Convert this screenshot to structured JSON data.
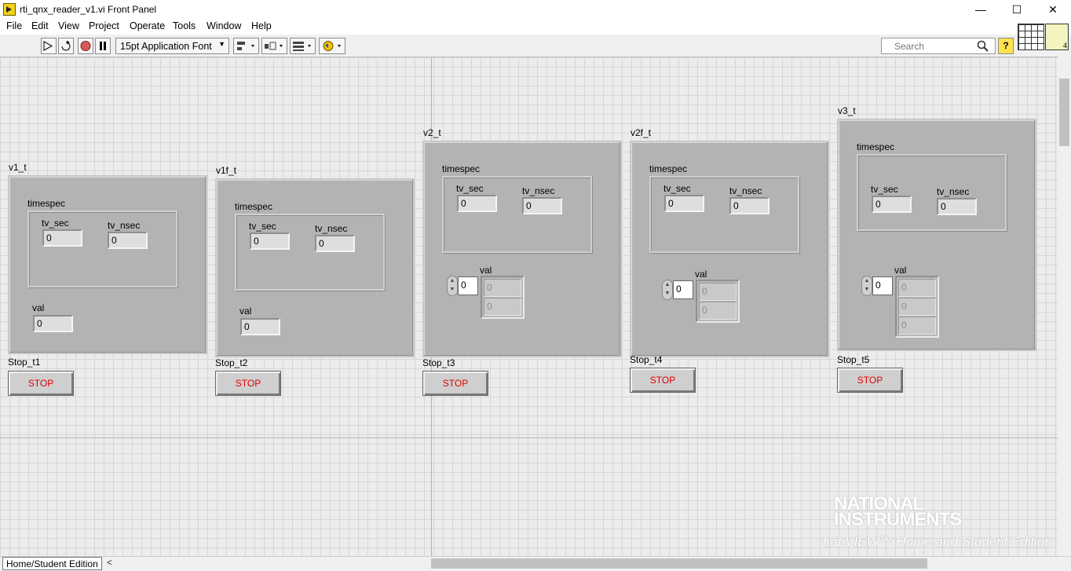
{
  "window": {
    "title": "rti_qnx_reader_v1.vi Front Panel",
    "minimize": "—",
    "maximize": "☐",
    "close": "✕"
  },
  "menu": [
    "File",
    "Edit",
    "View",
    "Project",
    "Operate",
    "Tools",
    "Window",
    "Help"
  ],
  "toolbar": {
    "font": "15pt Application Font",
    "icons": [
      "run-arrow-icon",
      "run-continuously-icon",
      "abort-icon",
      "pause-icon",
      "align-icon",
      "distribute-icon",
      "resize-icon",
      "reorder-icon"
    ],
    "search_placeholder": "Search",
    "help": "?"
  },
  "panel": {
    "clusters": [
      {
        "label": "v1_t",
        "timespec_label": "timespec",
        "sec_label": "tv_sec",
        "sec_value": "0",
        "nsec_label": "tv_nsec",
        "nsec_value": "0",
        "val_label": "val",
        "val_value": "0",
        "stop_label": "Stop_t1",
        "stop_text": "STOP"
      },
      {
        "label": "v1f_t",
        "timespec_label": "timespec",
        "sec_label": "tv_sec",
        "sec_value": "0",
        "nsec_label": "tv_nsec",
        "nsec_value": "0",
        "val_label": "val",
        "val_value": "0",
        "stop_label": "Stop_t2",
        "stop_text": "STOP"
      },
      {
        "label": "v2_t",
        "timespec_label": "timespec",
        "sec_label": "tv_sec",
        "sec_value": "0",
        "nsec_label": "tv_nsec",
        "nsec_value": "0",
        "val_label": "val",
        "index_value": "0",
        "array_values": [
          "0",
          "0"
        ],
        "stop_label": "Stop_t3",
        "stop_text": "STOP"
      },
      {
        "label": "v2f_t",
        "timespec_label": "timespec",
        "sec_label": "tv_sec",
        "sec_value": "0",
        "nsec_label": "tv_nsec",
        "nsec_value": "0",
        "val_label": "val",
        "index_value": "0",
        "array_values": [
          "0",
          "0"
        ],
        "stop_label": "Stop_t4",
        "stop_text": "STOP"
      },
      {
        "label": "v3_t",
        "timespec_label": "timespec",
        "sec_label": "tv_sec",
        "sec_value": "0",
        "nsec_label": "tv_nsec",
        "nsec_value": "0",
        "val_label": "val",
        "index_value": "0",
        "array_values": [
          "0",
          "0",
          "0"
        ],
        "stop_label": "Stop_t5",
        "stop_text": "STOP"
      }
    ]
  },
  "watermark": {
    "brand": "NATIONAL INSTRUMENTS",
    "edition": "LabVIEW™ Home and Student Edition"
  },
  "status": {
    "edition": "Home/Student Edition",
    "scroll_left": "<"
  }
}
